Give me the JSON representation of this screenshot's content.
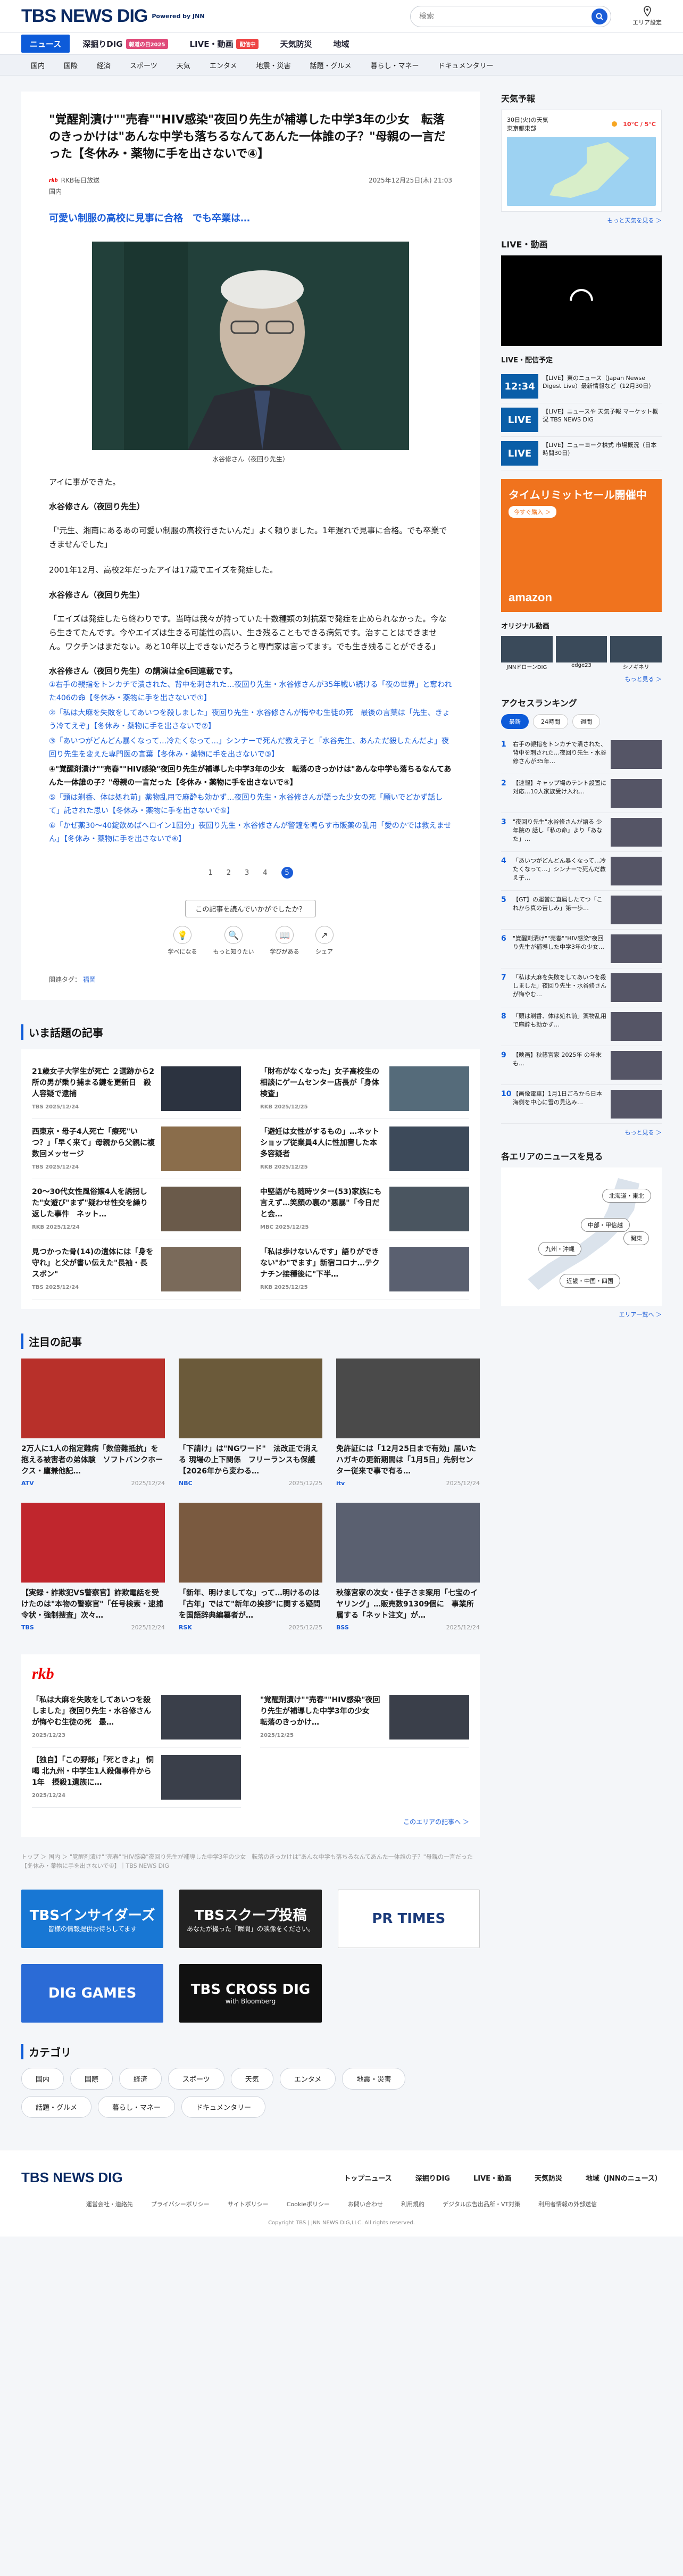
{
  "header": {
    "logo_text": "TBS NEWS DIG",
    "powered": "Powered by JNN",
    "search_placeholder": "検索",
    "area_label": "エリア設定"
  },
  "nav": [
    {
      "label": "ニュース",
      "active": true
    },
    {
      "label": "深掘りDIG",
      "badge": "報道の日2025",
      "badge_color": "#e04a7a"
    },
    {
      "label": "LIVE・動画",
      "badge": "配信中",
      "badge_color": "#e44"
    },
    {
      "label": "天気防災"
    },
    {
      "label": "地域"
    }
  ],
  "subnav": [
    "国内",
    "国際",
    "経済",
    "スポーツ",
    "天気",
    "エンタメ",
    "地震・災害",
    "話題・グルメ",
    "暮らし・マネー",
    "ドキュメンタリー"
  ],
  "article": {
    "title": "\"覚醒剤漬け\"\"売春\"\"HIV感染\"夜回り先生が補導した中学3年の少女　転落のきっかけは\"あんな中学も落ちるなんてあんた一体誰の子？\"母親の一言だった【冬休み・薬物に手を出さないで④】",
    "source": "RKB毎日放送",
    "date": "2025年12月25日(木) 21:03",
    "stamp": "国内",
    "lead": "可愛い制服の高校に見事に合格　でも卒業は…",
    "caption": "水谷修さん（夜回り先生）",
    "paras": [
      {
        "type": "p",
        "text": "アイに事ができた。"
      },
      {
        "type": "spk",
        "text": "水谷修さん（夜回り先生）"
      },
      {
        "type": "p",
        "text": "「'元生、湘南にあるあの可愛い制服の高校行きたいんだ」よく頼りました。1年遅れで見事に合格。でも卒業できませんでした」"
      },
      {
        "type": "p",
        "text": "2001年12月、高校2年だったアイは17歳でエイズを発症した。"
      },
      {
        "type": "spk",
        "text": "水谷修さん（夜回り先生）"
      },
      {
        "type": "p",
        "text": "「エイズは発症したら終わりです。当時は我々が持っていた十数種類の対抗薬で発症を止められなかった。今なら生きてたんです。今やエイズは生きる可能性の高い、生き残ることもできる病気です。治すことはできません。ワクチンはまだない。あと10年以上できないだろうと専門家は言ってます。でも生き残ることができる」"
      }
    ],
    "links_head": "水谷修さん（夜回り先生）の講演は全6回連載です。",
    "links": [
      {
        "text": "①右手の親指をトンカチで潰された、背中を刺された…夜回り先生・水谷修さんが35年戦い続ける「夜の世界」と奪われた406の命【冬休み・薬物に手を出さないで①】",
        "dark": false
      },
      {
        "text": "②「私は大麻を失敗をしてあいつを殺しました」夜回り先生・水谷修さんが悔やむ生徒の死　最後の言葉は「先生、きょう冷てえぞ」【冬休み・薬物に手を出さないで②】",
        "dark": false
      },
      {
        "text": "③「あいつがどんどん暴くなって…冷たくなって…」シンナーで死んだ教え子と「水谷先生、あんただ殺したんだよ」夜回り先生を変えた専門医の言葉【冬休み・薬物に手を出さないで③】",
        "dark": false
      },
      {
        "text": "④\"覚醒剤漬け\"\"売春\"\"HIV感染\"夜回り先生が補導した中学3年の少女　転落のきっかけは\"あんな中学も落ちるなんてあんた一体誰の子？\"母親の一言だった【冬休み・薬物に手を出さないで④】",
        "dark": true
      },
      {
        "text": "⑤「頭は剃香、体は処れ前」薬物乱用で麻酔も効かず…夜回り先生・水谷修さんが語った少女の死「願いでどかず話して」託された思い【冬休み・薬物に手を出さないで⑤】",
        "dark": false
      },
      {
        "text": "⑥「かぜ薬30〜40錠飲めばヘロイン1回分」夜回り先生・水谷修さんが警鐘を鳴らす市販薬の乱用「愛のかでは救えません」【冬休み・薬物に手を出さないで⑥】",
        "dark": false
      }
    ],
    "pages": [
      "1",
      "2",
      "3",
      "4",
      "5"
    ],
    "question": "この記事を読んでいかがでしたか？",
    "reacts": [
      "学べになる",
      "もっと知りたい",
      "学びがある",
      "シェア"
    ],
    "tags_label": "関連タグ：",
    "tags": "福岡"
  },
  "hot": {
    "title": "いま話題の記事",
    "items": [
      {
        "t": "21歳女子大学生が死亡 ２選跡から2所の男が乗り捕まる鍵を更新日　殺人容疑で逮捕",
        "src": "TBS",
        "d": "2025/12/24"
      },
      {
        "t": "「財布がなくなった」女子高校生の相談にゲームセンター店長が「身体検査」",
        "src": "RKB",
        "d": "2025/12/25"
      },
      {
        "t": "西東京・母子4人死亡「療死\"いつ？」「早く来て」母親から父親に複数回メッセージ",
        "src": "TBS",
        "d": "2025/12/24"
      },
      {
        "t": "「避妊は女性がするもの」…ネットショップ従業員4人に性加害した本多容疑者",
        "src": "RKB",
        "d": "2025/12/25"
      },
      {
        "t": "20〜30代女性風俗嬢4人を誘拐した\"女遊び\"まず\"疑わせ性交を繰り返した事件　ネット…",
        "src": "RKB",
        "d": "2025/12/24"
      },
      {
        "t": "中堅語がも随時ツター(53)家族にも言えず…笑顔の裏の\"悪暴\"「今日だと会…",
        "src": "MBC",
        "d": "2025/12/25"
      },
      {
        "t": "見つかった骨(14)の遺体には「身を守れ」と父が書い伝えた\"長袖・長スボン\"",
        "src": "TBS",
        "d": "2025/12/24"
      },
      {
        "t": "「私は歩けないんです」語りができない\"わ\"でます」新宿コロナ…テクナチン接種後に\"下半…",
        "src": "RKB",
        "d": "2025/12/25"
      }
    ]
  },
  "featured": {
    "title": "注目の記事",
    "items": [
      {
        "t": "2万人に1人の指定難病「数倍難抵抗」を抱える被害者の弟体験　ソフトバンクホークス・鷹兼他記…",
        "src": "ATV",
        "d": "2025/12/24"
      },
      {
        "t": "「下請け」は\"NGワード\"　法改正で消える 現場の上下関係　フリーランスも保護【2026年から変わる…",
        "src": "NBC",
        "d": "2025/12/25"
      },
      {
        "t": "免許証には「12月25日まで有効」届いたハガキの更新期間は「1月5日」先例センター従来で事で有る…",
        "src": "itv",
        "d": "2025/12/24"
      },
      {
        "t": "【実録・詐欺犯VS警察官】詐欺電話を受けたのは\"本物の警察官\"「任号検索・逮捕令状・強制捜査」次々…",
        "src": "TBS",
        "d": "2025/12/24"
      },
      {
        "t": "「新年、明けましてな」って…明けるのは「古年」ではて\"新年の挨拶\"に関する疑問を国語辞典編纂者が…",
        "src": "RSK",
        "d": "2025/12/25"
      },
      {
        "t": "秋篠宮家の次女・佳子さま案用「七宝のイヤリング」…販売数91309個に　事業所属する「ネット注文」が…",
        "src": "BSS",
        "d": "2025/12/24"
      }
    ]
  },
  "rkb": {
    "logo": "rkb",
    "items": [
      {
        "t": "「私は大麻を失敗をしてあいつを殺しました」夜回り先生・水谷修さんが悔やむ生徒の死　最…",
        "d": "2025/12/23"
      },
      {
        "t": "\"覚醒剤漬け\"\"売春\"\"HIV感染\"夜回り先生が補導した中学3年の少女　転落のきっかけ…",
        "d": "2025/12/25"
      },
      {
        "t": "【独自】「この野郎」「死ときよ」 恫喝 北九州・中学生1人殺傷事件から1年　摂殺1遺族に…",
        "d": "2025/12/24"
      }
    ],
    "more": "このエリアの記事へ ＞"
  },
  "breadcrumb": "トップ ＞ 国内 ＞ \"覚醒剤漬け\"\"売春\"\"HIV感染\"夜回り先生が補導した中学3年の少女　転落のきっかけは\"あんな中学も落ちるなんてあんた一体誰の子？\"母親の一言だった【冬休み・薬物に手を出さないで④】｜TBS NEWS DIG",
  "banners": [
    {
      "text": "TBSインサイダーズ",
      "sub": "皆様の情報提供お待ちしてます",
      "bg": "#1877d4",
      "fg": "#fff"
    },
    {
      "text": "TBSスクープ投稿",
      "sub": "あなたが撮った「瞬間」の映像をください。",
      "bg": "#222",
      "fg": "#fff"
    },
    {
      "text": "PR TIMES",
      "bg": "#fff",
      "fg": "#1a3a7a"
    },
    {
      "text": "DIG GAMES",
      "bg": "#2b6bd6",
      "fg": "#fff"
    },
    {
      "text": "TBS CROSS DIG",
      "sub": "with Bloomberg",
      "bg": "#111",
      "fg": "#fff"
    }
  ],
  "categories": {
    "title": "カテゴリ",
    "items": [
      "国内",
      "国際",
      "経済",
      "スポーツ",
      "天気",
      "エンタメ",
      "地震・災害",
      "話題・グルメ",
      "暮らし・マネー",
      "ドキュメンタリー"
    ]
  },
  "footer": {
    "logo": "TBS NEWS DIG",
    "nav": [
      "トップニュース",
      "深掘りDIG",
      "LIVE・動画",
      "天気防災",
      "地域（JNNのニュース）"
    ],
    "sub": [
      "運営会社・連絡先",
      "プライバシーポリシー",
      "サイトポリシー",
      "Cookieポリシー",
      "お問い合わせ",
      "利用規約",
      "デジタル広告出品所・VT対策",
      "利用者情報の外部送信"
    ],
    "copy": "Copyright TBS | JNN NEWS DIG,LLC. All rights reserved."
  },
  "side": {
    "weather_title": "天気予報",
    "weather_date": "30日(火)の天気",
    "weather_area": "東京都東部",
    "weather_temp": "10°C / 5°C",
    "weather_more": "もっと天気を見る ＞",
    "live_title": "LIVE・動画",
    "live_sched_title": "LIVE・配信予定",
    "live_items": [
      {
        "tm": "12:34",
        "t": "【LIVE】東のニュース（Japan Newse Digest Live）最新情報など（12月30日）"
      },
      {
        "tm": "LIVE",
        "t": "【LIVE】ニュースや 天気予報 マーケット概況 TBS NEWS DIG"
      },
      {
        "tm": "LIVE",
        "t": "【LIVE】ニューヨーク株式 市場概況（日本時間30日）"
      }
    ],
    "ad_title": "タイムリミットセール開催中",
    "ad_btn": "今すぐ購入 ＞",
    "ad_brand": "amazon",
    "original_title": "オリジナル動画",
    "original_items": [
      "JNNドローンDIG",
      "edge23",
      "シノギネリ"
    ],
    "original_more": "もっと見る ＞",
    "ranking_title": "アクセスランキング",
    "ranking_tabs": [
      "最新",
      "24時間",
      "週間"
    ],
    "ranking": [
      "右手の親指をトンカチで潰された、背中を刺された…夜回り先生・水谷修さんが35年…",
      "【速報】キャップ場のテント設置に 対応…10人家族受け入れ…",
      "\"夜回り先生\"水谷修さんが語る 少年院の 話し「私の命」より「あなた」…",
      "「あいつがどんどん暴くなって…冷たくなって…」シンナーで死んだ教え子…",
      "【GT】の運営に直属したてつ「これから真の苦しみ」第一歩…",
      "\"覚醒剤漬け\"\"売春\"\"HIV感染\"夜回り先生が補導した中学3年の少女…",
      "「私は大麻を失敗をしてあいつを殺しました」夜回り先生・水谷修さんが悔やむ…",
      "「頭は剃香、体は処れ前」薬物乱用で麻酔も効かず…",
      "【映画】秋篠宮家 2025年 の年末も…",
      "【画像電車】1月1日ごろから日本海側を中心に雪の見込み…"
    ],
    "ranking_more": "もっと見る ＞",
    "area_title": "各エリアのニュースを見る",
    "area_buttons": [
      "北海道・東北",
      "中部・甲信越",
      "九州・沖縄",
      "関東",
      "近畿・中国・四国"
    ],
    "area_more": "エリア一覧へ ＞"
  }
}
